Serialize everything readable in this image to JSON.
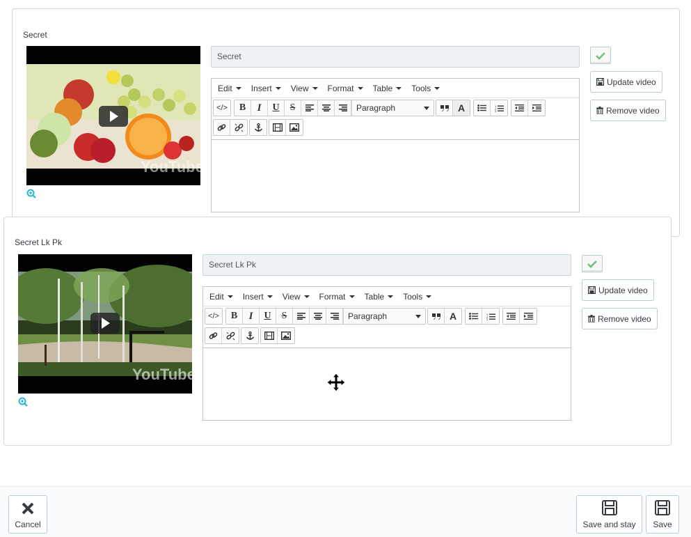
{
  "videos": [
    {
      "heading": "Secret",
      "title_value": "Secret",
      "thumbnail_variant": "fruit",
      "watermark": "YouTube"
    },
    {
      "heading": "Secret Lk Pk",
      "title_value": "Secret Lk Pk",
      "thumbnail_variant": "park",
      "watermark": "YouTube"
    }
  ],
  "editor": {
    "menus": [
      "Edit",
      "Insert",
      "View",
      "Format",
      "Table",
      "Tools"
    ],
    "block_format": "Paragraph",
    "icons": {
      "source": "</>",
      "bold": "B",
      "italic": "I",
      "underline": "U",
      "strike": "S"
    }
  },
  "actions": {
    "update_label": "Update video",
    "remove_label": "Remove video"
  },
  "footer": {
    "cancel_label": "Cancel",
    "save_stay_label": "Save and stay",
    "save_label": "Save"
  },
  "colors": {
    "check_green": "#72c279",
    "zoom_blue": "#25b9d7",
    "border": "#bbcdd2"
  }
}
